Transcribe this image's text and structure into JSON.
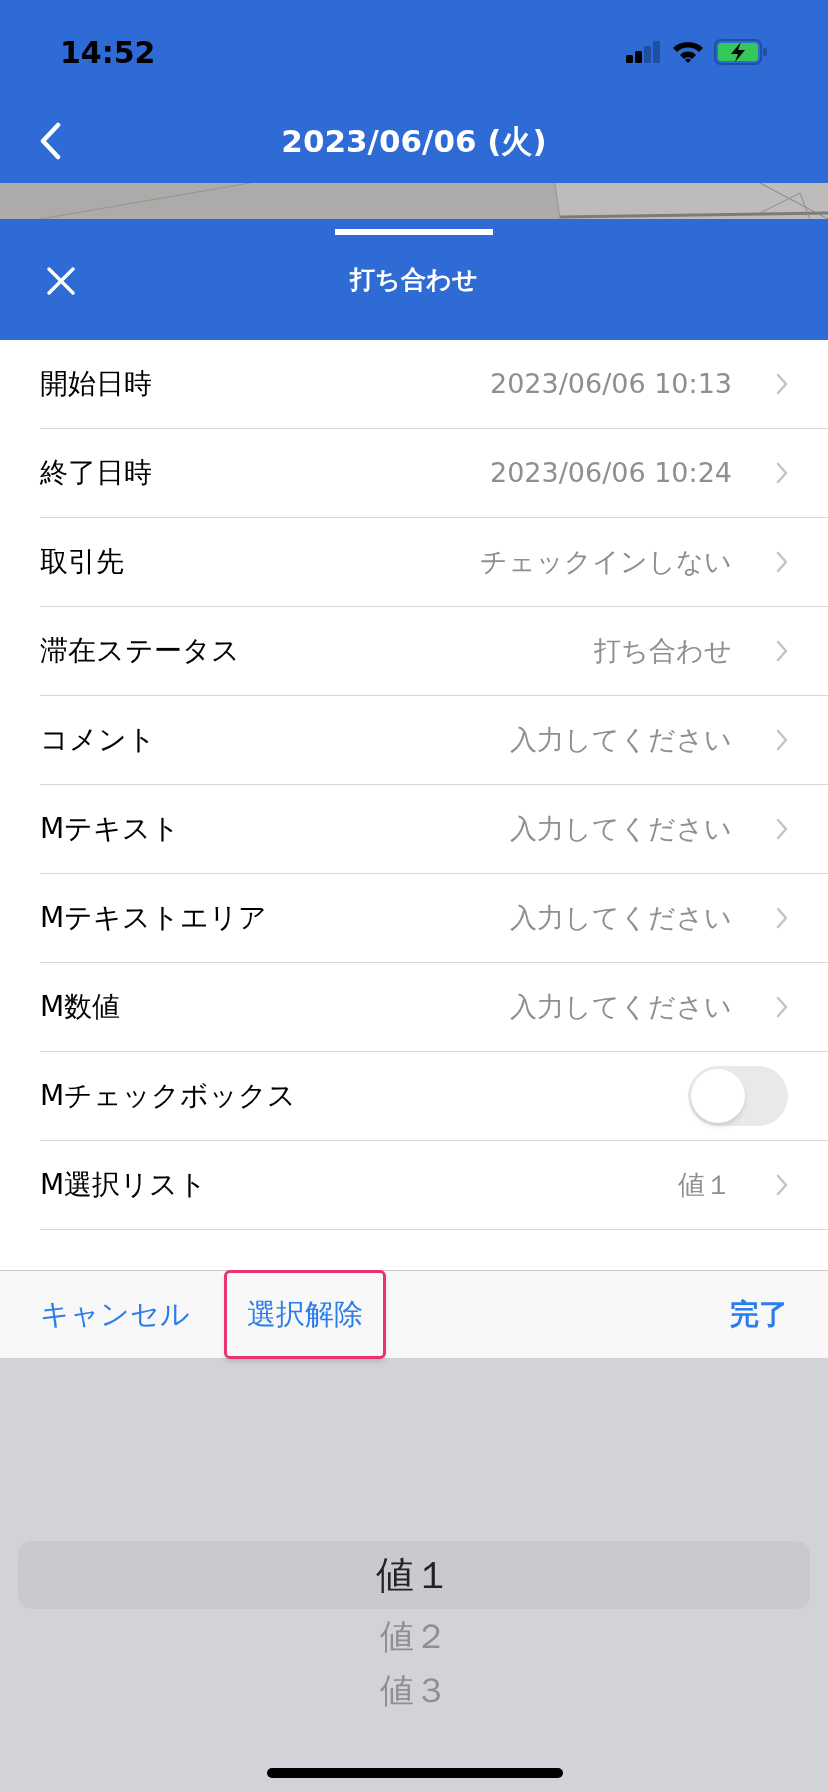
{
  "status_bar": {
    "time": "14:52"
  },
  "nav": {
    "title": "2023/06/06 (火)"
  },
  "sheet": {
    "title": "打ち合わせ"
  },
  "rows": [
    {
      "kind": "link",
      "label": "開始日時",
      "value": "2023/06/06 10:13"
    },
    {
      "kind": "link",
      "label": "終了日時",
      "value": "2023/06/06 10:24"
    },
    {
      "kind": "link",
      "label": "取引先",
      "value": "チェックインしない"
    },
    {
      "kind": "link",
      "label": "滞在ステータス",
      "value": "打ち合わせ"
    },
    {
      "kind": "link",
      "label": "コメント",
      "value": "入力してください"
    },
    {
      "kind": "link",
      "label": "Mテキスト",
      "value": "入力してください"
    },
    {
      "kind": "link",
      "label": "Mテキストエリア",
      "value": "入力してください"
    },
    {
      "kind": "link",
      "label": "M数値",
      "value": "入力してください"
    },
    {
      "kind": "toggle",
      "label": "Mチェックボックス",
      "on": false
    },
    {
      "kind": "link",
      "label": "M選択リスト",
      "value": "値１"
    }
  ],
  "toolbar": {
    "cancel": "キャンセル",
    "clear": {
      "label": "選択解除",
      "highlighted": true
    },
    "done": "完了"
  },
  "picker": [
    {
      "label": "値１",
      "selected": true
    },
    {
      "label": "値２",
      "selected": false
    },
    {
      "label": "値３",
      "selected": false
    }
  ]
}
